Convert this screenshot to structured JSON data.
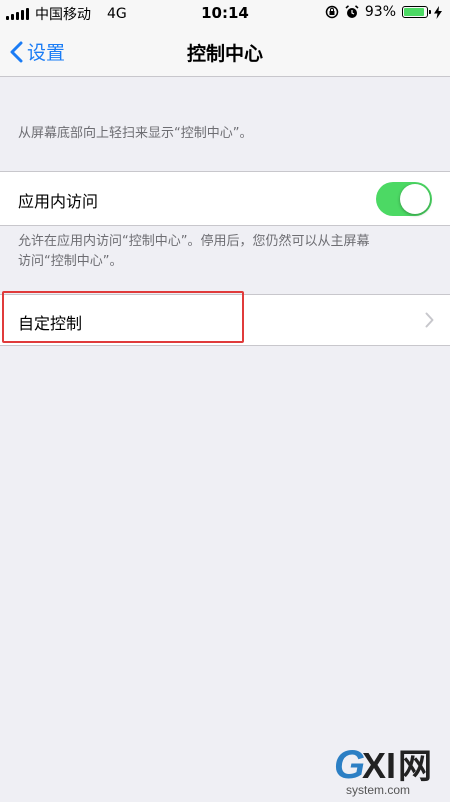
{
  "status_bar": {
    "carrier": "中国移动",
    "network": "4G",
    "time": "10:14",
    "battery_percent": "93%",
    "battery_level": 0.93,
    "icons": [
      "signal-icon",
      "rotation-lock-icon",
      "alarm-icon",
      "battery-icon",
      "charging-icon"
    ]
  },
  "nav": {
    "back_label": "设置",
    "title": "控制中心"
  },
  "content": {
    "swipe_hint": "从屏幕底部向上轻扫来显示“控制中心”。",
    "in_app_access": {
      "label": "应用内访问",
      "enabled": true,
      "description_line1": "允许在应用内访问“控制中心”。停用后，您仍然可以从主屏幕",
      "description_line2": "访问“控制中心”。"
    },
    "customize": {
      "label": "自定控制"
    }
  },
  "watermark": {
    "main": "GXI网",
    "sub": "system.com"
  },
  "colors": {
    "accent": "#1a7cf5",
    "toggle_on": "#4cd964",
    "highlight": "#e03b3b",
    "background": "#efeff4"
  }
}
